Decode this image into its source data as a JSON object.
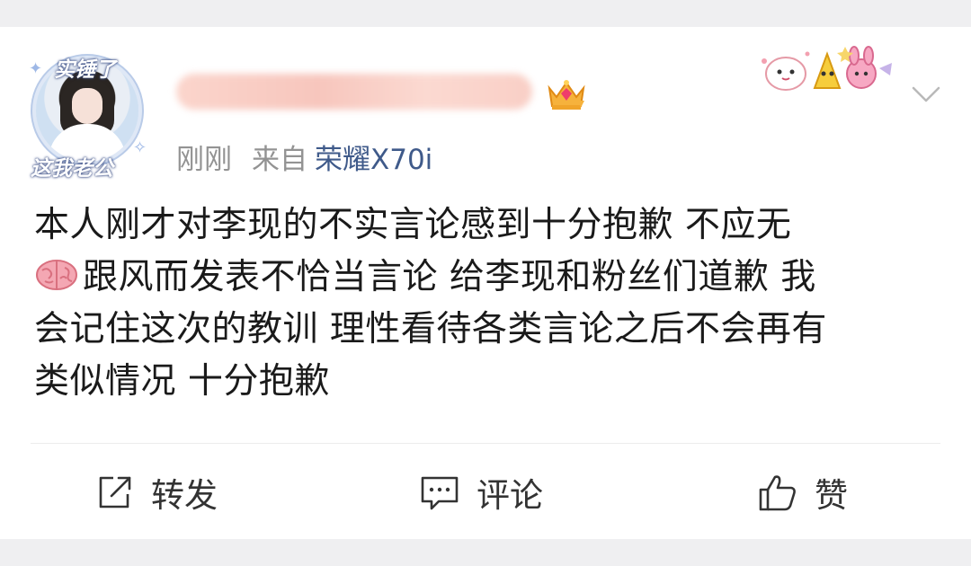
{
  "post": {
    "avatar_frame": {
      "top_text": "实锤了",
      "bottom_text": "这我老公"
    },
    "username": "",
    "meta": {
      "time": "刚刚",
      "from_label": "来自",
      "source": "荣耀X70i"
    },
    "text_lines": [
      "本人刚才对李现的不实言论感到十分抱歉 不应无",
      "跟风而发表不恰当言论 给李现和粉丝们道歉 我",
      "会记住这次的教训 理性看待各类言论之后不会再有",
      "类似情况 十分抱歉"
    ],
    "brain_emoji_icon": "brain-icon"
  },
  "actions": {
    "repost_label": "转发",
    "comment_label": "评论",
    "like_label": "赞"
  },
  "colors": {
    "source_link": "#3f5a8a",
    "meta_gray": "#939393",
    "text": "#1a1a1a",
    "background": "#efeff1"
  }
}
